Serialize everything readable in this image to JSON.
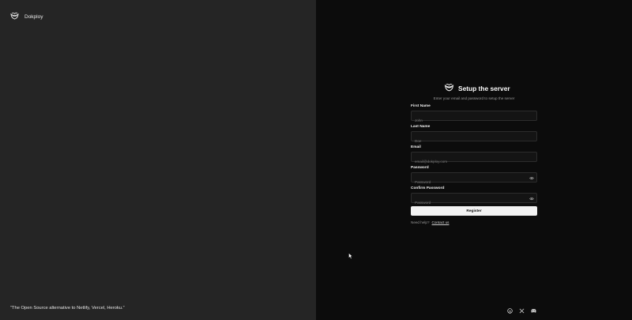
{
  "brand": {
    "name": "Dokploy",
    "logo_icon": "dokploy-logo-icon"
  },
  "tagline": "“The Open Source alternative to Netlify, Vercel, Heroku.”",
  "setup": {
    "title": "Setup the server",
    "subtitle": "Enter your email and password to setup the server",
    "fields": {
      "first_name": {
        "label": "First Name",
        "placeholder": "John"
      },
      "last_name": {
        "label": "Last Name",
        "placeholder": "Doe"
      },
      "email": {
        "label": "Email",
        "placeholder": "email@dokploy.com"
      },
      "password": {
        "label": "Password",
        "placeholder": "Password"
      },
      "confirm_password": {
        "label": "Confirm Password",
        "placeholder": "Password"
      }
    },
    "register_label": "Register",
    "help_text": "Need help?",
    "contact_label": "Contact us"
  },
  "social_icons": [
    "github-icon",
    "x-icon",
    "discord-icon"
  ],
  "colors": {
    "left_bg": "#252525",
    "right_bg": "#0c0c0c",
    "button_bg": "#f2f2f2",
    "input_border": "#2c2c2c"
  }
}
